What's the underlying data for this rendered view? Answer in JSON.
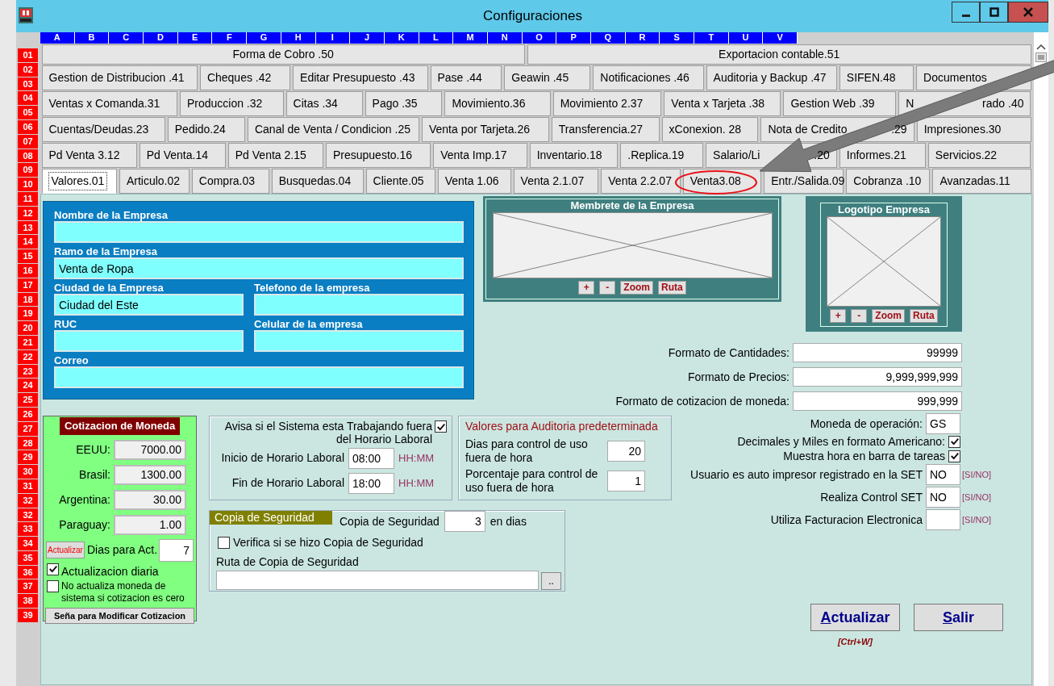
{
  "window": {
    "title": "Configuraciones"
  },
  "column_letters": [
    "A",
    "B",
    "C",
    "D",
    "E",
    "F",
    "G",
    "H",
    "I",
    "J",
    "K",
    "L",
    "M",
    "N",
    "O",
    "P",
    "Q",
    "R",
    "S",
    "T",
    "U",
    "V"
  ],
  "row_numbers": [
    "01",
    "02",
    "03",
    "04",
    "05",
    "06",
    "07",
    "08",
    "09",
    "10",
    "11",
    "12",
    "13",
    "14",
    "15",
    "16",
    "17",
    "18",
    "19",
    "20",
    "21",
    "22",
    "23",
    "24",
    "25",
    "26",
    "27",
    "28",
    "29",
    "30",
    "31",
    "32",
    "32",
    "33",
    "34",
    "35",
    "36",
    "37",
    "38",
    "39"
  ],
  "tabs": [
    [
      {
        "label": "Forma de Cobro .50",
        "selected": false
      },
      {
        "label": "Exportacion contable.51",
        "selected": false
      }
    ],
    [
      {
        "label": "Gestion de  Distribucion .41",
        "selected": false
      },
      {
        "label": "Cheques .42",
        "selected": false
      },
      {
        "label": "Editar Presupuesto .43",
        "selected": false
      },
      {
        "label": "Pase .44",
        "selected": false
      },
      {
        "label": "Geawin .45",
        "selected": false
      },
      {
        "label": "Notificaciones .46",
        "selected": false
      },
      {
        "label": "Auditoria y Backup .47",
        "selected": false
      },
      {
        "label": "SIFEN.48",
        "selected": false
      },
      {
        "label": "Documentos",
        "selected": false
      }
    ],
    [
      {
        "label": "Ventas x Comanda.31",
        "selected": false
      },
      {
        "label": "Produccion .32",
        "selected": false
      },
      {
        "label": "Citas .34",
        "selected": false
      },
      {
        "label": "Pago .35",
        "selected": false
      },
      {
        "label": "Movimiento.36",
        "selected": false
      },
      {
        "label": "Movimiento 2.37",
        "selected": false
      },
      {
        "label": "Venta x Tarjeta .38",
        "selected": false
      },
      {
        "label": "Gestion Web .39",
        "selected": false
      },
      {
        "label": "N",
        "tail": "rado .40",
        "selected": false
      }
    ],
    [
      {
        "label": "Cuentas/Deudas.23",
        "selected": false
      },
      {
        "label": "Pedido.24",
        "selected": false
      },
      {
        "label": "Canal de Venta / Condicion .25",
        "selected": false
      },
      {
        "label": "Venta por Tarjeta.26",
        "selected": false
      },
      {
        "label": "Transferencia.27",
        "selected": false
      },
      {
        "label": "xConexion. 28",
        "selected": false
      },
      {
        "label": "Nota de Credito",
        "tail": ".29",
        "selected": false
      },
      {
        "label": "Impresiones.30",
        "selected": false
      }
    ],
    [
      {
        "label": "Pd Venta 3.12",
        "selected": false
      },
      {
        "label": "Pd Venta.14",
        "selected": false
      },
      {
        "label": "Pd Venta 2.15",
        "selected": false
      },
      {
        "label": "Presupuesto.16",
        "selected": false
      },
      {
        "label": "Venta  Imp.17",
        "selected": false
      },
      {
        "label": "Inventario.18",
        "selected": false
      },
      {
        "label": ".Replica.19",
        "selected": false
      },
      {
        "label": "Salario/Li",
        "tail": ".20",
        "selected": false
      },
      {
        "label": "Informes.21",
        "selected": false
      },
      {
        "label": "Servicios.22",
        "selected": false
      }
    ],
    [
      {
        "label": "Valores.01",
        "selected": true
      },
      {
        "label": "Articulo.02",
        "selected": false
      },
      {
        "label": "Compra.03",
        "selected": false
      },
      {
        "label": "Busquedas.04",
        "selected": false
      },
      {
        "label": "Cliente.05",
        "selected": false
      },
      {
        "label": "Venta 1.06",
        "selected": false
      },
      {
        "label": "Venta 2.1.07",
        "selected": false
      },
      {
        "label": "Venta 2.2.07",
        "selected": false
      },
      {
        "label": "Venta3.08",
        "selected": false
      },
      {
        "label": "Entr./Salida.09",
        "selected": false
      },
      {
        "label": "Cobranza .10",
        "selected": false
      },
      {
        "label": "Avanzadas.11",
        "selected": false
      }
    ]
  ],
  "company": {
    "rows": [
      [
        {
          "label": "Nombre de  la Empresa"
        }
      ],
      [
        {
          "label": "Ramo de la Empresa",
          "value": "Venta de Ropa"
        }
      ],
      [
        {
          "label": "Ciudad de la Empresa",
          "value": "Ciudad del Este"
        },
        {
          "label": "Telefono de la empresa"
        }
      ],
      [
        {
          "label": "RUC"
        },
        {
          "label": "Celular de la empresa"
        }
      ],
      [
        {
          "label": "Correo"
        }
      ]
    ]
  },
  "images": [
    {
      "title": "Membrete de la Empresa",
      "buttons": [
        "+",
        "-",
        "Zoom",
        "Ruta"
      ]
    },
    {
      "title": "Logotipo Empresa",
      "buttons": [
        "+",
        "-",
        "Zoom",
        "Ruta"
      ]
    }
  ],
  "formats": [
    {
      "label": "Formato de Cantidades:",
      "value": "99999"
    },
    {
      "label": "Formato de Precios:",
      "value": "9,999,999,999"
    },
    {
      "label": "Formato de cotizacion de moneda:",
      "value": "999,999"
    }
  ],
  "currency": {
    "title": "Cotizacion de Moneda",
    "rates": [
      {
        "label": "EEUU:",
        "value": "7000.00"
      },
      {
        "label": "Brasil:",
        "value": "1300.00"
      },
      {
        "label": "Argentina:",
        "value": "30.00"
      },
      {
        "label": "Paraguay:",
        "value": "1.00"
      }
    ],
    "update_button": "Actualizar",
    "days_label": "Dias para Act.",
    "days_value": "7",
    "options": [
      {
        "label": "Actualizacion diaria",
        "checked": true
      },
      {
        "label": "No actualiza moneda de sistema si cotizacion es cero",
        "checked": false
      }
    ],
    "password_button": "Seña para Modificar Cotizacion"
  },
  "work_hours": {
    "warn": {
      "label": "Avisa si el Sistema esta Trabajando fuera del Horario Laboral",
      "checked": true
    },
    "rows": [
      {
        "label": "Inicio de Horario Laboral",
        "value": "08:00",
        "hint": "HH:MM"
      },
      {
        "label": "Fin de Horario Laboral",
        "value": "18:00",
        "hint": "HH:MM"
      }
    ]
  },
  "audit": {
    "title": "Valores para Auditoria predeterminada",
    "rows": [
      {
        "label": "Dias para control de uso fuera de hora",
        "value": "20"
      },
      {
        "label": "Porcentaje para control de uso fuera de hora",
        "value": "1"
      }
    ]
  },
  "backup": {
    "title": "Copia de Seguridad",
    "days_label": "Copia de Seguridad",
    "days_value": "3",
    "days_unit": "en dias",
    "verify": {
      "label": "Verifica si se hizo Copia de Seguridad",
      "checked": false
    },
    "path_label": "Ruta de Copia de Seguridad",
    "browse_button": ".."
  },
  "settings": [
    {
      "kind": "field",
      "label": "Moneda de operación:",
      "value": "GS"
    },
    {
      "kind": "check",
      "label": "Decimales y Miles en formato Americano:",
      "checked": true
    },
    {
      "kind": "check",
      "label": "Muestra hora en barra de tareas",
      "checked": true
    },
    {
      "kind": "field",
      "label": "Usuario es auto impresor registrado en la SET",
      "value": "NO",
      "hint": "[SI/NO]"
    },
    {
      "kind": "field",
      "label": "Realiza Control SET",
      "value": "NO",
      "hint": "[SI/NO]"
    },
    {
      "kind": "field",
      "label": "Utiliza Facturacion Electronica",
      "hint": "[SI/NO]"
    }
  ],
  "actions": [
    {
      "label": "Actualizar",
      "mnemonic": true,
      "shortcut": "[Ctrl+W]"
    },
    {
      "label": "Salir",
      "mnemonic": true
    }
  ]
}
